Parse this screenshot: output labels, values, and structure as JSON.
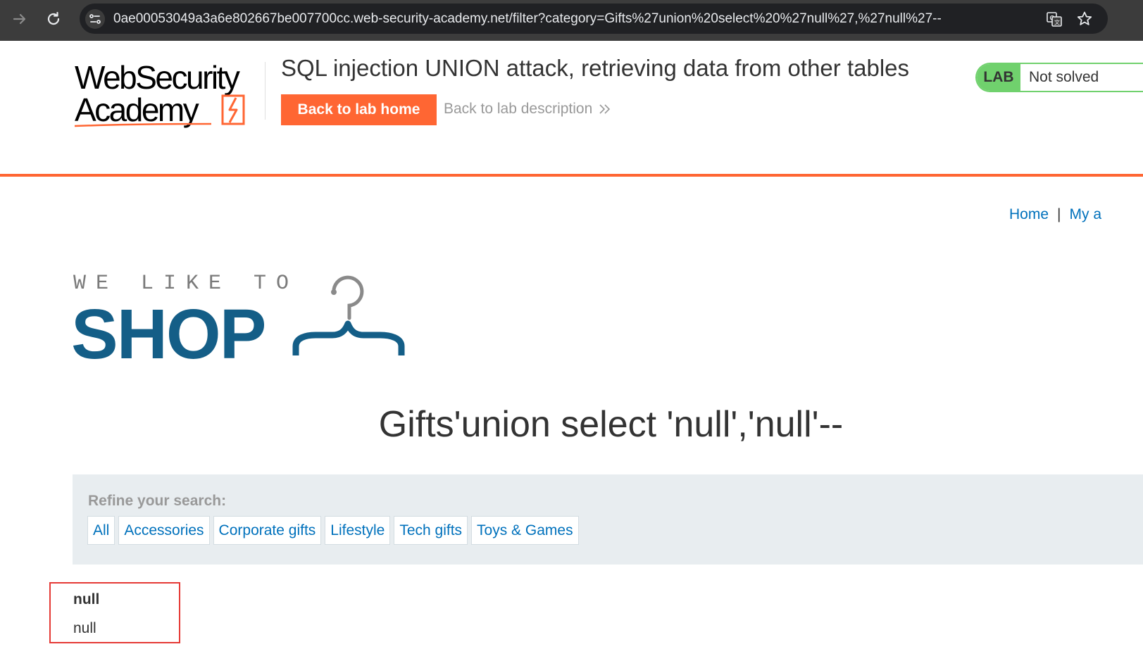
{
  "browser": {
    "url": "0ae00053049a3a6e802667be007700cc.web-security-academy.net/filter?category=Gifts%27union%20select%20%27null%27,%27null%27--",
    "icons": [
      "forward-arrow-icon",
      "reload-icon",
      "site-info-icon",
      "translate-icon",
      "bookmark-star-icon"
    ]
  },
  "lab_header": {
    "logo_line1": "WebSecurity",
    "logo_line2": "Academy",
    "title": "SQL injection UNION attack, retrieving data from other tables",
    "back_home_label": "Back to lab home",
    "back_description_label": "Back to lab description",
    "badge_label": "LAB",
    "status": "Not solved",
    "colors": {
      "accent": "#ff6633",
      "badge": "#70d16d",
      "link": "#0071bc"
    }
  },
  "top_nav": {
    "home": "Home",
    "separator": "|",
    "my_account": "My a"
  },
  "shop_logo": {
    "tagline": "WE LIKE TO",
    "word": "SHOP",
    "color": "#145e87"
  },
  "page": {
    "heading": "Gifts'union select 'null','null'--"
  },
  "filter": {
    "label": "Refine your search:",
    "categories": [
      "All",
      "Accessories",
      "Corporate gifts",
      "Lifestyle",
      "Tech gifts",
      "Toys & Games"
    ]
  },
  "results": [
    {
      "title": "null",
      "body": "null"
    }
  ]
}
